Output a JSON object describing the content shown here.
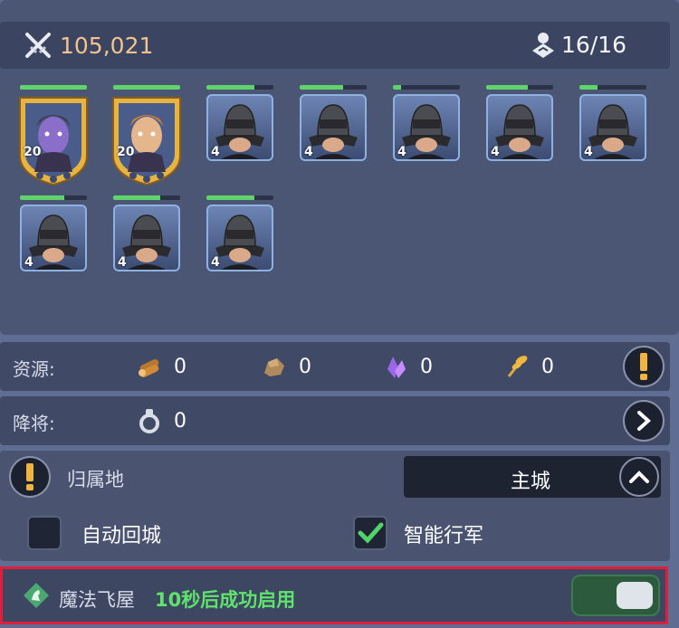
{
  "header": {
    "power_value": "105,021",
    "capacity_value": "16/16",
    "power_icon": "crossed-swords-icon",
    "capacity_icon": "troop-capacity-icon"
  },
  "units": [
    {
      "type": "hero-purple",
      "level": "20",
      "health": 1.0
    },
    {
      "type": "hero-aviator",
      "level": "20",
      "health": 1.0
    },
    {
      "type": "helmet-soldier",
      "level": "4",
      "health": 0.72
    },
    {
      "type": "helmet-soldier",
      "level": "4",
      "health": 0.65
    },
    {
      "type": "helmet-soldier",
      "level": "4",
      "health": 0.12
    },
    {
      "type": "helmet-soldier",
      "level": "4",
      "health": 0.62
    },
    {
      "type": "helmet-soldier",
      "level": "4",
      "health": 0.27
    },
    {
      "type": "helmet-soldier",
      "level": "4",
      "health": 0.66
    },
    {
      "type": "helmet-soldier",
      "level": "4",
      "health": 0.7
    },
    {
      "type": "helmet-soldier",
      "level": "4",
      "health": 0.72
    }
  ],
  "resources": {
    "label": "资源:",
    "items": [
      {
        "icon": "wood-icon",
        "value": "0"
      },
      {
        "icon": "stone-icon",
        "value": "0"
      },
      {
        "icon": "crystal-icon",
        "value": "0"
      },
      {
        "icon": "wheat-icon",
        "value": "0"
      }
    ]
  },
  "captives": {
    "label": "降将:",
    "icon": "shackle-icon",
    "value": "0"
  },
  "home": {
    "label": "归属地",
    "selected": "主城"
  },
  "options": {
    "auto_return": {
      "label": "自动回城",
      "checked": false
    },
    "smart_march": {
      "label": "智能行军",
      "checked": true
    }
  },
  "flying_house": {
    "name": "魔法飞屋",
    "status": "10秒后成功启用"
  },
  "colors": {
    "accent_green": "#5fd46a",
    "power_gold": "#f2c38d",
    "warning_red": "#e01d3a"
  }
}
